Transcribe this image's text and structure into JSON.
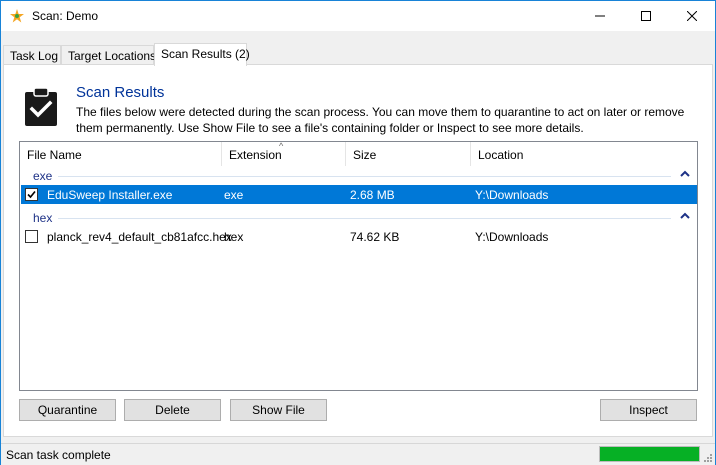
{
  "window": {
    "title": "Scan: Demo"
  },
  "tabs": [
    {
      "label": "Task Log"
    },
    {
      "label": "Target Locations"
    },
    {
      "label": "Scan Results (2)"
    }
  ],
  "header": {
    "title": "Scan Results",
    "description": "The files below were detected during the scan process. You can move them to quarantine to act on later or remove them permanently. Use Show File to see a file's containing folder or Inspect to see more details."
  },
  "list": {
    "columns": [
      "File Name",
      "Extension",
      "Size",
      "Location"
    ],
    "sorted_column": "Extension",
    "groups": [
      {
        "name": "exe",
        "rows": [
          {
            "checked": true,
            "selected": true,
            "name": "EduSweep Installer.exe",
            "ext": "exe",
            "size": "2.68 MB",
            "location": "Y:\\Downloads"
          }
        ]
      },
      {
        "name": "hex",
        "rows": [
          {
            "checked": false,
            "selected": false,
            "name": "planck_rev4_default_cb81afcc.hex",
            "ext": "hex",
            "size": "74.62 KB",
            "location": "Y:\\Downloads"
          }
        ]
      }
    ]
  },
  "buttons": {
    "quarantine": "Quarantine",
    "delete": "Delete",
    "show_file": "Show File",
    "inspect": "Inspect"
  },
  "status": {
    "text": "Scan task complete",
    "progress": 1.0
  },
  "colors": {
    "accent": "#0078d7",
    "heading": "#003399",
    "progress": "#06b025"
  }
}
